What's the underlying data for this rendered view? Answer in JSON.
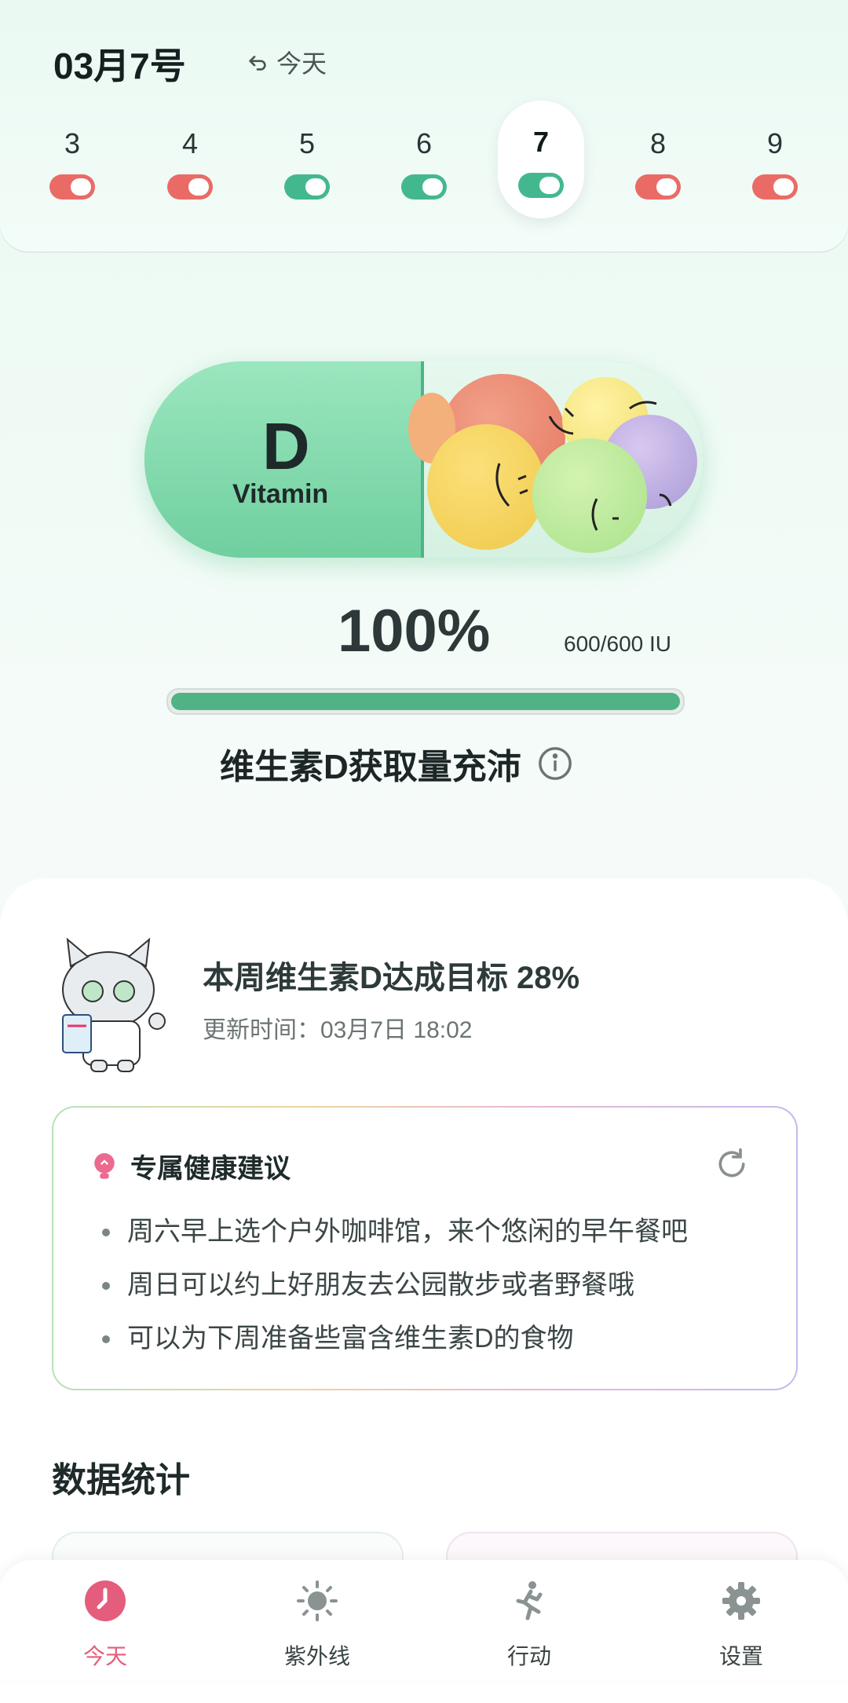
{
  "header": {
    "date_title": "03月7号",
    "today_label": "今天",
    "days": [
      {
        "num": "3",
        "status": "red"
      },
      {
        "num": "4",
        "status": "red"
      },
      {
        "num": "5",
        "status": "green"
      },
      {
        "num": "6",
        "status": "green"
      },
      {
        "num": "7",
        "status": "green",
        "selected": true
      },
      {
        "num": "8",
        "status": "red"
      },
      {
        "num": "9",
        "status": "red"
      }
    ]
  },
  "capsule": {
    "letter": "D",
    "label": "Vitamin"
  },
  "progress": {
    "percent_text": "100%",
    "iu_text": "600/600 IU",
    "fraction": 1.0,
    "status_text": "维生素D获取量充沛"
  },
  "weekly": {
    "title": "本周维生素D达成目标 28%",
    "update_time": "更新时间：03月7日 18:02"
  },
  "advice": {
    "title": "专属健康建议",
    "items": [
      "周六早上选个户外咖啡馆，来个悠闲的早午餐吧",
      "周日可以约上好朋友去公园散步或者野餐哦",
      "可以为下周准备些富含维生素D的食物"
    ]
  },
  "stats": {
    "title": "数据统计"
  },
  "nav": {
    "items": [
      {
        "label": "今天",
        "icon": "clock-icon",
        "active": true
      },
      {
        "label": "紫外线",
        "icon": "sun-icon"
      },
      {
        "label": "行动",
        "icon": "running-icon"
      },
      {
        "label": "设置",
        "icon": "gear-icon"
      }
    ]
  },
  "colors": {
    "accent_green": "#4fb386",
    "status_red": "#ea6b66",
    "active_pink": "#e55d7c"
  }
}
